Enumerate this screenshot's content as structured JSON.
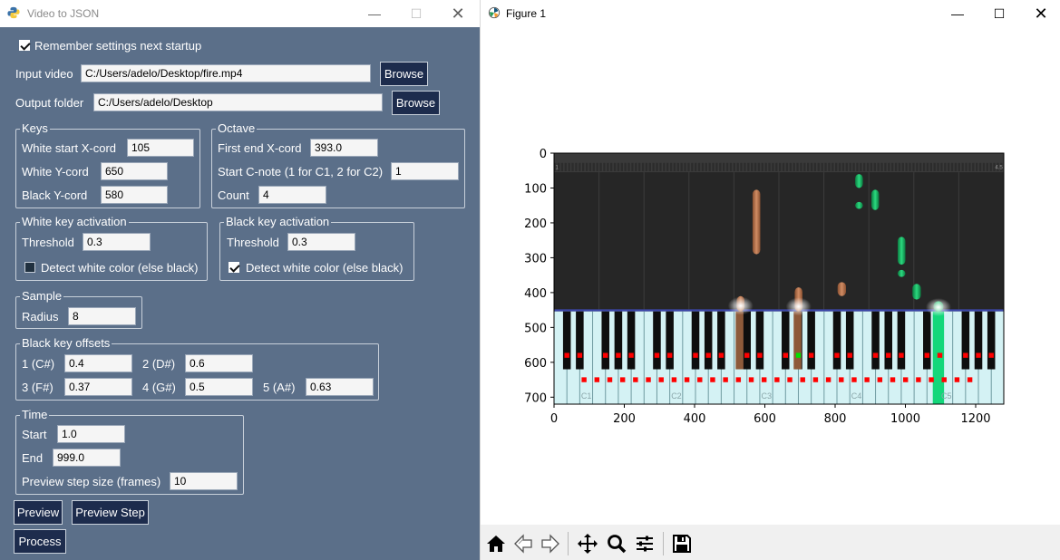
{
  "left_window": {
    "title": "Video to JSON",
    "remember_settings": {
      "label": "Remember settings next startup",
      "checked": true
    },
    "input_video": {
      "label": "Input video",
      "value": "C:/Users/adelo/Desktop/fire.mp4",
      "browse": "Browse"
    },
    "output_folder": {
      "label": "Output folder",
      "value": "C:/Users/adelo/Desktop",
      "browse": "Browse"
    },
    "keys": {
      "title": "Keys",
      "white_start_label": "White start X-cord",
      "white_start": "105",
      "white_y_label": "White Y-cord",
      "white_y": "650",
      "black_y_label": "Black Y-cord",
      "black_y": "580"
    },
    "octave": {
      "title": "Octave",
      "first_end_label": "First end X-cord",
      "first_end": "393.0",
      "start_c_label": "Start C-note (1 for C1, 2 for C2)",
      "start_c": "1",
      "count_label": "Count",
      "count": "4"
    },
    "white_activation": {
      "title": "White key activation",
      "threshold_label": "Threshold",
      "threshold": "0.3",
      "detect_label": "Detect white color (else black)",
      "detect_checked": false
    },
    "black_activation": {
      "title": "Black key activation",
      "threshold_label": "Threshold",
      "threshold": "0.3",
      "detect_label": "Detect white color (else black)",
      "detect_checked": true
    },
    "sample": {
      "title": "Sample",
      "radius_label": "Radius",
      "radius": "8"
    },
    "black_offsets": {
      "title": "Black key offsets",
      "c_sharp_label": "1 (C#)",
      "c_sharp": "0.4",
      "d_sharp_label": "2 (D#)",
      "d_sharp": "0.6",
      "f_sharp_label": "3 (F#)",
      "f_sharp": "0.37",
      "g_sharp_label": "4 (G#)",
      "g_sharp": "0.5",
      "a_sharp_label": "5 (A#)",
      "a_sharp": "0.63"
    },
    "time": {
      "title": "Time",
      "start_label": "Start",
      "start": "1.0",
      "end_label": "End",
      "end": "999.0",
      "step_label": "Preview step size (frames)",
      "step": "10"
    },
    "buttons": {
      "preview": "Preview",
      "preview_step": "Preview Step",
      "process": "Process"
    }
  },
  "right_window": {
    "title": "Figure 1",
    "plot": {
      "x_ticks": [
        "0",
        "200",
        "400",
        "600",
        "800",
        "1000",
        "1200"
      ],
      "y_ticks": [
        "0",
        "100",
        "200",
        "300",
        "400",
        "500",
        "600",
        "700"
      ],
      "x_range": [
        0,
        1280
      ],
      "y_range": [
        720,
        0
      ],
      "octave_labels": [
        "C1",
        "C2",
        "C3",
        "C4",
        "C5"
      ],
      "timeline_marks": [
        "1",
        "4.5"
      ]
    },
    "toolbar": [
      "home-icon",
      "back-icon",
      "forward-icon",
      "pan-icon",
      "zoom-icon",
      "configure-icon",
      "save-icon"
    ]
  },
  "colors": {
    "panel_bg": "#5b6f89",
    "button_bg": "#1d2c4d",
    "note_orange": "#c47a52",
    "note_green": "#2bd97f",
    "sample_red": "#ff0000",
    "sample_green": "#00e000"
  }
}
